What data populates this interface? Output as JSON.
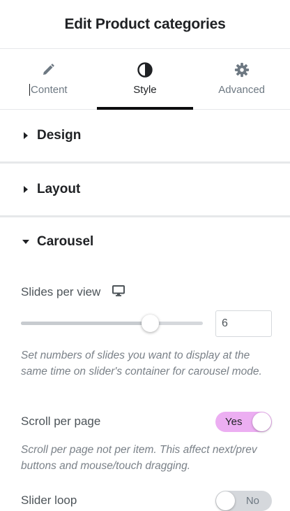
{
  "header": {
    "title": "Edit Product categories"
  },
  "tabs": [
    {
      "label": "Content",
      "icon": "pencil-icon",
      "active": false
    },
    {
      "label": "Style",
      "icon": "contrast-icon",
      "active": true
    },
    {
      "label": "Advanced",
      "icon": "gear-icon",
      "active": false
    }
  ],
  "sections": {
    "design": {
      "title": "Design",
      "expanded": false
    },
    "layout": {
      "title": "Layout",
      "expanded": false
    },
    "carousel": {
      "title": "Carousel",
      "expanded": true
    }
  },
  "carousel": {
    "slides_per_view": {
      "label": "Slides per view",
      "device_icon": "desktop-monitor-icon",
      "value": "6",
      "slider_fraction": 0.71,
      "description": "Set numbers of slides you want to display at the same time on slider's container for carousel mode."
    },
    "scroll_per_page": {
      "label": "Scroll per page",
      "state_label": "Yes",
      "on": true,
      "description": "Scroll per page not per item. This affect next/prev buttons and mouse/touch dragging."
    },
    "slider_loop": {
      "label": "Slider loop",
      "state_label": "No",
      "on": false
    }
  },
  "colors": {
    "switch_on": "#ecaef2",
    "switch_off": "#d5d8dc",
    "active_tab_indicator": "#0c0d0e"
  }
}
